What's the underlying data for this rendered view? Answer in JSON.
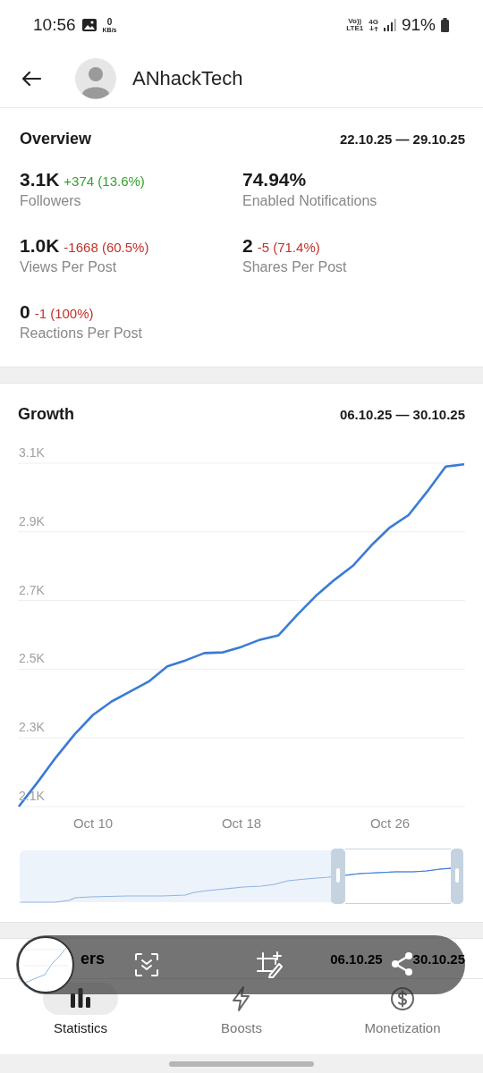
{
  "status_bar": {
    "time": "10:56",
    "speed_value": "0",
    "speed_unit": "KB/s",
    "volte": "Vo))",
    "lte": "LTE1",
    "network": "4G",
    "battery": "91%"
  },
  "header": {
    "title": "ANhackTech"
  },
  "overview": {
    "title": "Overview",
    "date_range": "22.10.25 — 29.10.25",
    "stats": [
      {
        "value": "3.1K",
        "change": "+374 (13.6%)",
        "kind": "gain",
        "label": "Followers"
      },
      {
        "value": "74.94%",
        "label": "Enabled Notifications"
      },
      {
        "value": "1.0K",
        "change": "-1668 (60.5%)",
        "kind": "loss",
        "label": "Views Per Post"
      },
      {
        "value": "2",
        "change": "-5 (71.4%)",
        "kind": "loss",
        "label": "Shares Per Post"
      },
      {
        "value": "0",
        "change": "-1 (100%)",
        "kind": "loss",
        "label": "Reactions Per Post"
      }
    ]
  },
  "growth": {
    "title": "Growth",
    "date_range": "06.10.25 — 30.10.25",
    "chart_data": {
      "type": "line",
      "categories": [
        null,
        null,
        null,
        null,
        "Oct 10",
        null,
        null,
        null,
        null,
        null,
        null,
        null,
        "Oct 18",
        null,
        null,
        null,
        null,
        null,
        null,
        null,
        "Oct 26",
        null,
        null,
        null,
        null
      ],
      "series": [
        {
          "color": "#3a7bd5",
          "values": [
            2100,
            2170,
            2243,
            2310,
            2367,
            2406,
            2435,
            2464,
            2508,
            2526,
            2547,
            2549,
            2565,
            2586,
            2599,
            2658,
            2713,
            2760,
            2801,
            2861,
            2913,
            2949,
            3017,
            3090,
            3097
          ]
        }
      ],
      "ylim": [
        2100,
        3100
      ],
      "grid": true,
      "yticks": [
        {
          "value": 2100,
          "label": "2.1K"
        },
        {
          "value": 2300,
          "label": "2.3K"
        },
        {
          "value": 2500,
          "label": "2.5K"
        },
        {
          "value": 2700,
          "label": "2.7K"
        },
        {
          "value": 2900,
          "label": "2.9K"
        },
        {
          "value": 3100,
          "label": "3.1K"
        }
      ]
    }
  },
  "next_section": {
    "title": "ers",
    "date_start": "06.10.25",
    "date_end": "30.10.25"
  },
  "bottom_nav": [
    {
      "label": "Statistics",
      "selected": true
    },
    {
      "label": "Boosts",
      "selected": false
    },
    {
      "label": "Monetization",
      "selected": false
    }
  ]
}
